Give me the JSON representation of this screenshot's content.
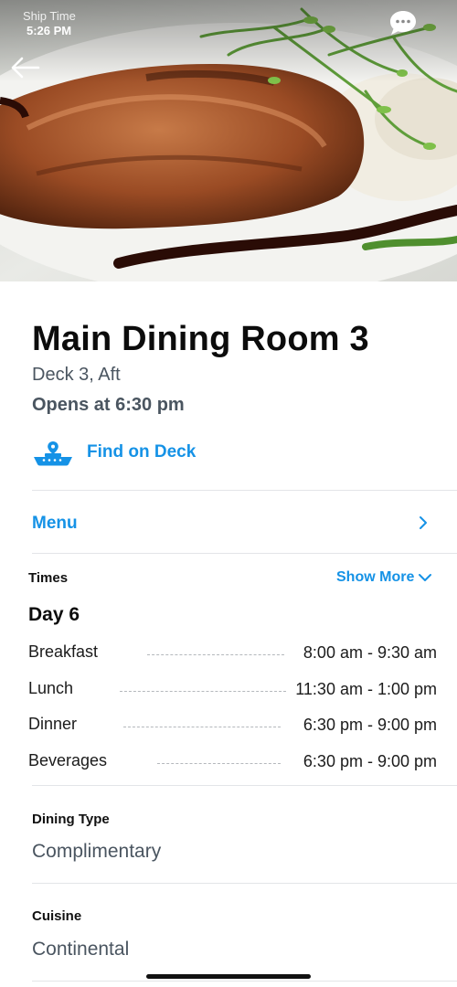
{
  "status": {
    "label": "Ship Time",
    "time": "5:26 PM"
  },
  "venue": {
    "title": "Main Dining Room 3",
    "location": "Deck 3, Aft",
    "opens": "Opens at 6:30 pm",
    "find_label": "Find on Deck"
  },
  "menu": {
    "label": "Menu"
  },
  "times": {
    "label": "Times",
    "show_more": "Show More",
    "day": "Day 6",
    "rows": [
      {
        "name": "Breakfast",
        "hours": "8:00 am - 9:30 am"
      },
      {
        "name": "Lunch",
        "hours": "11:30 am - 1:00 pm"
      },
      {
        "name": "Dinner",
        "hours": "6:30 pm - 9:00 pm"
      },
      {
        "name": "Beverages",
        "hours": "6:30 pm - 9:00 pm"
      }
    ]
  },
  "dining_type": {
    "label": "Dining Type",
    "value": "Complimentary"
  },
  "cuisine": {
    "label": "Cuisine",
    "value": "Continental"
  },
  "icons": {
    "back": "arrow-left-icon",
    "chat": "chat-bubble-icon",
    "ship": "ship-location-icon",
    "chevron_right": "chevron-right-icon",
    "chevron_down": "chevron-down-icon"
  },
  "colors": {
    "accent": "#1592e6",
    "subtext": "#4a5560",
    "divider": "#e3e5e8"
  }
}
